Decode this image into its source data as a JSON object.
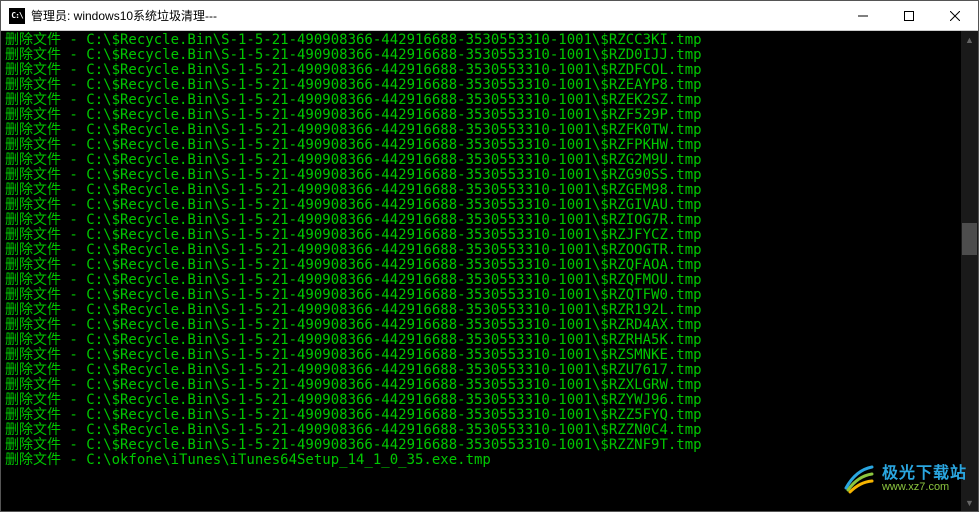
{
  "window": {
    "title": "管理员:  windows10系统垃圾清理---"
  },
  "terminal": {
    "prefix": "删除文件 - ",
    "base_path": "C:\\$Recycle.Bin\\S-1-5-21-490908366-442916688-3530553310-1001\\",
    "suffix": ".tmp",
    "files": [
      "$RZCC3KI",
      "$RZD0IJJ",
      "$RZDFCOL",
      "$RZEAYP8",
      "$RZEK2SZ",
      "$RZF529P",
      "$RZFK0TW",
      "$RZFPKHW",
      "$RZG2M9U",
      "$RZG90SS",
      "$RZGEM98",
      "$RZGIVAU",
      "$RZIOG7R",
      "$RZJFYCZ",
      "$RZOOGTR",
      "$RZQFAOA",
      "$RZQFMOU",
      "$RZQTFW0",
      "$RZR192L",
      "$RZRD4AX",
      "$RZRHA5K",
      "$RZSMNKE",
      "$RZU7617",
      "$RZXLGRW",
      "$RZYWJ96",
      "$RZZ5FYQ",
      "$RZZN0C4",
      "$RZZNF9T"
    ],
    "last_line": "删除文件 - C:\\okfone\\iTunes\\iTunes64Setup_14_1_0_35.exe.tmp"
  },
  "watermark": {
    "brand_cn": "极光下载站",
    "brand_url": "www.xz7.com"
  },
  "colors": {
    "terminal_fg": "#00c800",
    "terminal_bg": "#000000",
    "brand_blue": "#2aa6e0",
    "brand_green": "#8cc63f"
  }
}
